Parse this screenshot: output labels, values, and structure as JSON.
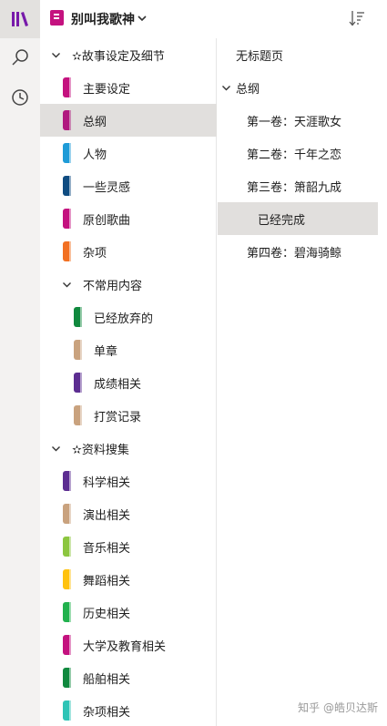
{
  "header": {
    "notebook_title": "别叫我歌神",
    "notebook_color": "#c4127f"
  },
  "rail": {
    "items": [
      {
        "icon": "notebooks-icon",
        "active": true
      },
      {
        "icon": "search-icon",
        "active": false
      },
      {
        "icon": "recent-icon",
        "active": false
      }
    ]
  },
  "sections": [
    {
      "kind": "group",
      "label": "✫故事设定及细节",
      "expanded": true
    },
    {
      "kind": "section",
      "label": "主要设定",
      "color": "#c4127f"
    },
    {
      "kind": "section",
      "label": "总纲",
      "color": "#b0187f",
      "selected": true
    },
    {
      "kind": "section",
      "label": "人物",
      "color": "#1e9bd7"
    },
    {
      "kind": "section",
      "label": "一些灵感",
      "color": "#0f4c81"
    },
    {
      "kind": "section",
      "label": "原创歌曲",
      "color": "#c4127f"
    },
    {
      "kind": "section",
      "label": "杂项",
      "color": "#f27022"
    },
    {
      "kind": "subgroup",
      "label": "不常用内容",
      "expanded": true
    },
    {
      "kind": "subsection",
      "label": "已经放弃的",
      "color": "#10893e"
    },
    {
      "kind": "subsection",
      "label": "单章",
      "color": "#c9a27e"
    },
    {
      "kind": "subsection",
      "label": "成绩相关",
      "color": "#5c2d91"
    },
    {
      "kind": "subsection",
      "label": "打赏记录",
      "color": "#c9a27e"
    },
    {
      "kind": "group",
      "label": "✫资料搜集",
      "expanded": true
    },
    {
      "kind": "section",
      "label": "科学相关",
      "color": "#5c2d91"
    },
    {
      "kind": "section",
      "label": "演出相关",
      "color": "#c9a27e"
    },
    {
      "kind": "section",
      "label": "音乐相关",
      "color": "#8cc63f"
    },
    {
      "kind": "section",
      "label": "舞蹈相关",
      "color": "#ffc20e"
    },
    {
      "kind": "section",
      "label": "历史相关",
      "color": "#21b14d"
    },
    {
      "kind": "section",
      "label": "大学及教育相关",
      "color": "#c4127f"
    },
    {
      "kind": "section",
      "label": "船舶相关",
      "color": "#10893e"
    },
    {
      "kind": "section",
      "label": "杂项相关",
      "color": "#2ec4b6"
    }
  ],
  "pages": [
    {
      "label": "无标题页",
      "level": 0
    },
    {
      "label": "总纲",
      "level": 0,
      "expander": true
    },
    {
      "label": "第一卷：天涯歌女",
      "level": 1
    },
    {
      "label": "第二卷：千年之恋",
      "level": 1
    },
    {
      "label": "第三卷：箫韶九成",
      "level": 1
    },
    {
      "label": "已经完成",
      "level": 2,
      "selected": true
    },
    {
      "label": "第四卷：碧海骑鲸",
      "level": 1
    }
  ],
  "watermark": "知乎 @皓贝达斯"
}
